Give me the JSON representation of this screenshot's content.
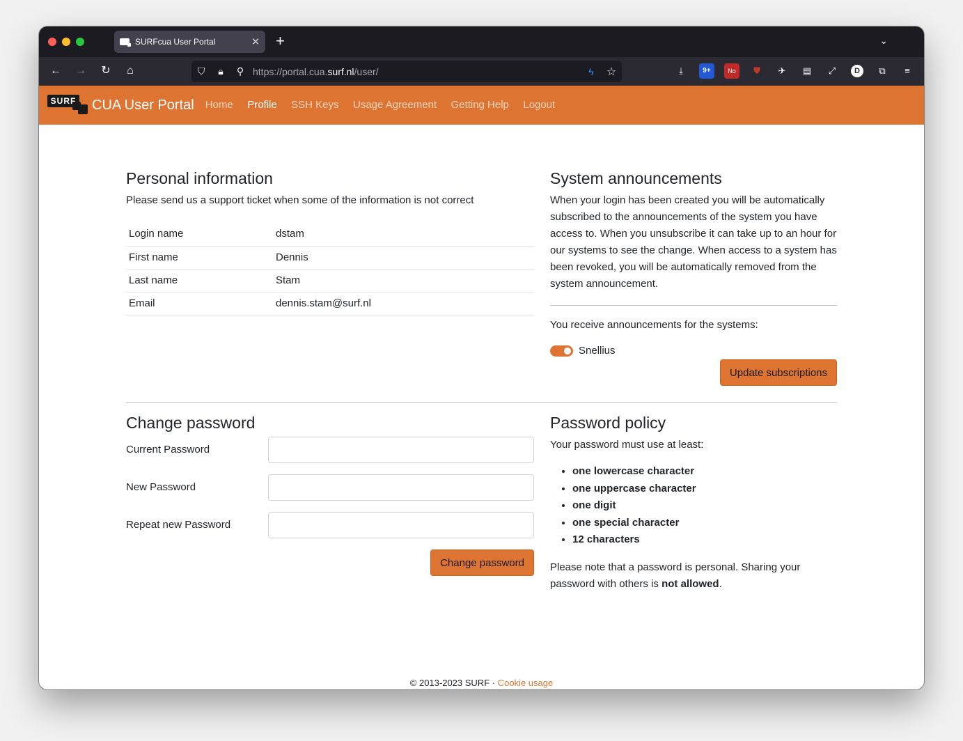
{
  "browser": {
    "tab_title": "SURFcua User Portal",
    "tab_close": "✕",
    "new_tab": "+",
    "url_prefix": "https://portal.cua.",
    "url_host": "surf.nl",
    "url_path": "/user/",
    "ext_badge_count": "9+",
    "ext_red_badge": "No",
    "avatar_letter": "D"
  },
  "site": {
    "logo_text": "SURF",
    "brand": "CUA User Portal",
    "menu": [
      {
        "label": "Home"
      },
      {
        "label": "Profile"
      },
      {
        "label": "SSH Keys"
      },
      {
        "label": "Usage Agreement"
      },
      {
        "label": "Getting Help"
      },
      {
        "label": "Logout"
      }
    ]
  },
  "personal": {
    "title": "Personal information",
    "subtitle": "Please send us a support ticket when some of the information is not correct",
    "rows": [
      {
        "key": "Login name",
        "value": "dstam"
      },
      {
        "key": "First name",
        "value": "Dennis"
      },
      {
        "key": "Last name",
        "value": "Stam"
      },
      {
        "key": "Email",
        "value": "dennis.stam@surf.nl"
      }
    ]
  },
  "announcements": {
    "title": "System announcements",
    "text": "When your login has been created you will be automatically subscribed to the announcements of the system you have access to. When you unsubscribe it can take up to an hour for our systems to see the change. When access to a system has been revoked, you will be automatically removed from the system announcement.",
    "receive_text": "You receive announcements for the systems:",
    "system": "Snellius",
    "button": "Update subscriptions"
  },
  "change_password": {
    "title": "Change password",
    "current_label": "Current Password",
    "new_label": "New Password",
    "repeat_label": "Repeat new Password",
    "button": "Change password"
  },
  "policy": {
    "title": "Password policy",
    "intro": "Your password must use at least:",
    "items": [
      "one lowercase character",
      "one uppercase character",
      "one digit",
      "one special character",
      "12 characters"
    ],
    "note_start": "Please note that a password is personal. Sharing your password with others is ",
    "note_bold": "not allowed",
    "note_end": "."
  },
  "footer": {
    "copyright": "© 2013-2023 SURF · ",
    "link": "Cookie usage"
  },
  "colors": {
    "brand_orange": "#de7431"
  }
}
